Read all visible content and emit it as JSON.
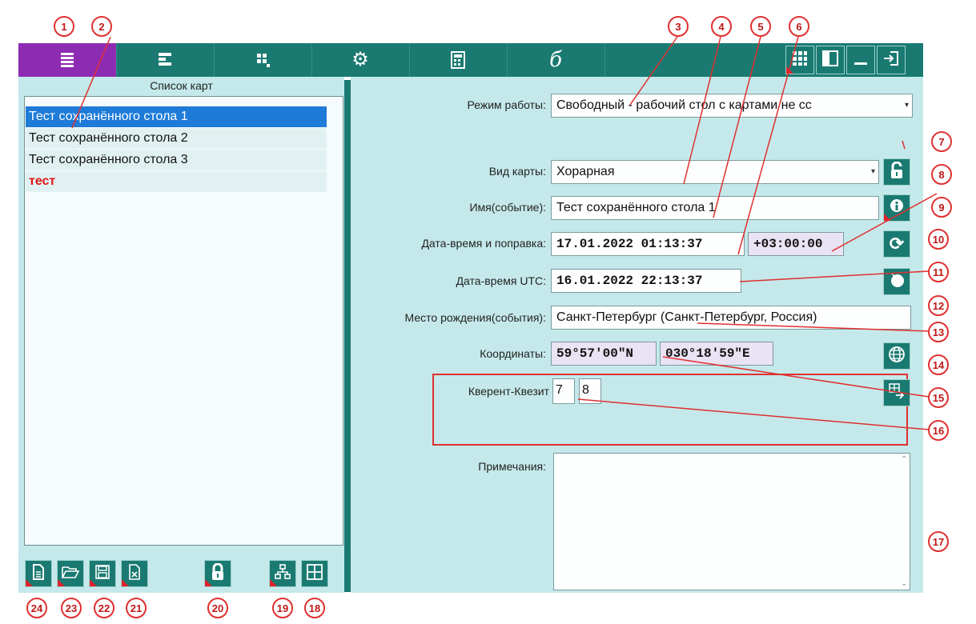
{
  "tabs": [
    {
      "icon": "list-lines-icon",
      "active": true
    },
    {
      "icon": "half-list-icon",
      "active": false
    },
    {
      "icon": "grid-dots-icon",
      "active": false
    },
    {
      "icon": "gear-icon",
      "active": false
    },
    {
      "icon": "calculator-icon",
      "active": false
    },
    {
      "icon": "script-logo-icon",
      "active": false
    }
  ],
  "window_buttons": [
    "grid-icon",
    "panel-icon",
    "minimize-icon",
    "exit-icon"
  ],
  "left_panel": {
    "title": "Список карт",
    "items": [
      {
        "label": "Тест сохранённого стола 1",
        "selected": true
      },
      {
        "label": "Тест сохранённого стола 2",
        "selected": false
      },
      {
        "label": "Тест сохранённого стола 3",
        "selected": false
      },
      {
        "label": "тест",
        "selected": false,
        "color": "#e01515"
      }
    ]
  },
  "form": {
    "mode_label": "Режим работы:",
    "mode_value": "Свободный - рабочий стол с картами не сс",
    "chart_type_label": "Вид карты:",
    "chart_type_value": "Хорарная",
    "name_label": "Имя(событие):",
    "name_value": "Тест сохранённого стола 1",
    "datetime_label": "Дата-время и поправка:",
    "datetime_value": "17.01.2022 01:13:37",
    "offset_value": "+03:00:00",
    "utc_label": "Дата-время UTC:",
    "utc_value": "16.01.2022 22:13:37",
    "place_label": "Место рождения(события):",
    "place_value": "Санкт-Петербург (Санкт-Петербург, Россия)",
    "coords_label": "Координаты:",
    "lat_value": "59°57'00\"N",
    "lon_value": "030°18'59\"E",
    "querent_label": "Кверент-Квезит",
    "querent_value": "7",
    "quesited_value": "8",
    "notes_label": "Примечания:",
    "notes_value": ""
  },
  "callouts": [
    "1",
    "2",
    "3",
    "4",
    "5",
    "6",
    "7",
    "8",
    "9",
    "10",
    "11",
    "12",
    "13",
    "14",
    "15",
    "16",
    "17",
    "18",
    "19",
    "20",
    "21",
    "22",
    "23",
    "24"
  ],
  "colors": {
    "teal": "#1a7a72",
    "panel": "#c5e9ea",
    "active_tab": "#8e2bb3",
    "selection": "#1e7bd8",
    "callout": "#e03030"
  }
}
